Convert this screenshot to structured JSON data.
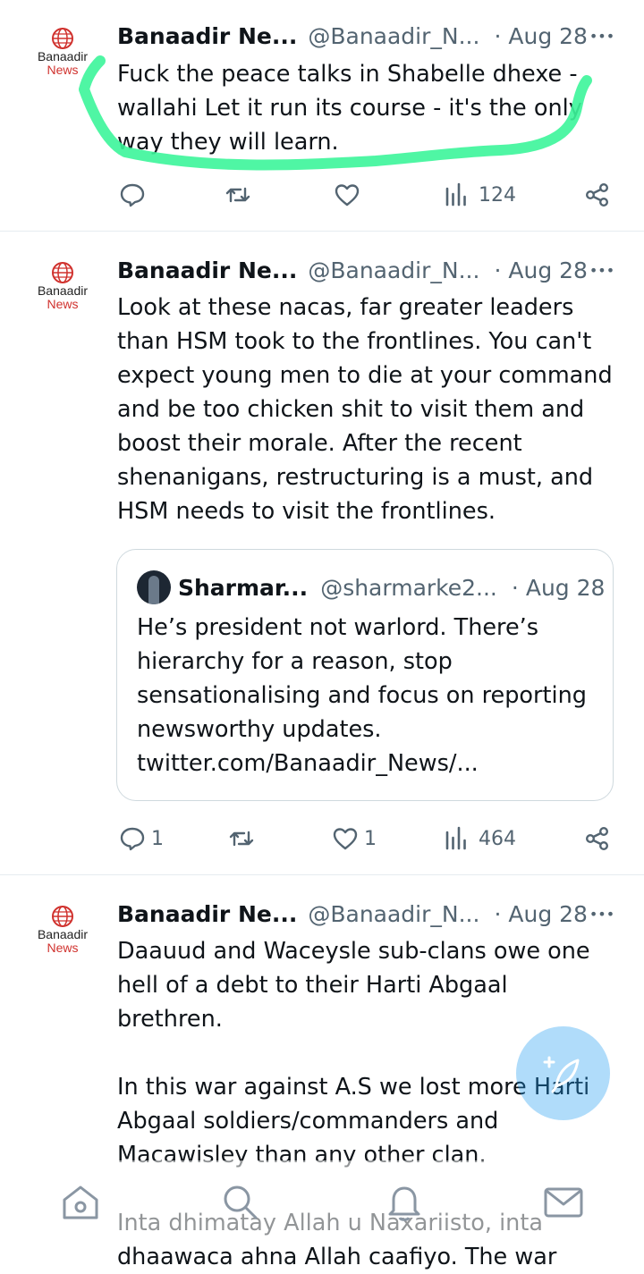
{
  "tweets": [
    {
      "avatar": {
        "line1": "Banaadir",
        "line2": "News"
      },
      "name": "Banaadir Ne...",
      "handle": "@Banaadir_N...",
      "sep": "·",
      "date": "Aug 28",
      "more": "•••",
      "text": "Fuck the peace talks in Shabelle dhexe -\nwallahi Let it run its course - it's the only\nway they will learn.",
      "reply_count": "",
      "retweet_count": "",
      "like_count": "",
      "views_count": "124"
    },
    {
      "avatar": {
        "line1": "Banaadir",
        "line2": "News"
      },
      "name": "Banaadir Ne...",
      "handle": "@Banaadir_N...",
      "sep": "·",
      "date": "Aug 28",
      "more": "•••",
      "text": "Look at these nacas, far greater leaders\nthan HSM took to the frontlines. You can't\nexpect young men to die at your command\nand be too chicken shit to visit them and\nboost their morale. After the recent\nshenanigans, restructuring is a must, and\nHSM needs to visit the frontlines.",
      "quote": {
        "name": "Sharmar...",
        "handle": "@sharmarke2...",
        "sep": "·",
        "date": "Aug 28",
        "text": "He’s president not warlord. There’s\nhierarchy for a reason, stop\nsensationalising and focus on reporting\nnewsworthy updates.\ntwitter.com/Banaadir_News/..."
      },
      "reply_count": "1",
      "retweet_count": "",
      "like_count": "1",
      "views_count": "464"
    },
    {
      "avatar": {
        "line1": "Banaadir",
        "line2": "News"
      },
      "name": "Banaadir Ne...",
      "handle": "@Banaadir_N...",
      "sep": "·",
      "date": "Aug 28",
      "more": "•••",
      "text": "Daauud and Waceysle sub-clans owe one\nhell of a debt to their Harti Abgaal brethren.\n\nIn this war against A.S we lost more Harti\nAbgaal soldiers/commanders and\nMacawisley than any other clan.\n\nInta dhimatay Allah u Naxariisto, inta\ndhaawaca ahna Allah caafiyo. The war"
    }
  ],
  "icons": {
    "reply": "reply-icon",
    "retweet": "retweet-icon",
    "like": "like-icon",
    "views": "views-icon",
    "share": "share-icon",
    "compose": "compose-icon",
    "home": "home-icon",
    "search": "search-icon",
    "notifications": "bell-icon",
    "messages": "mail-icon"
  },
  "colors": {
    "text": "#0f1419",
    "muted": "#536471",
    "brand_blue": "#1d9bf0",
    "highlight_green": "#3cf59a",
    "news_red": "#d0312d"
  }
}
